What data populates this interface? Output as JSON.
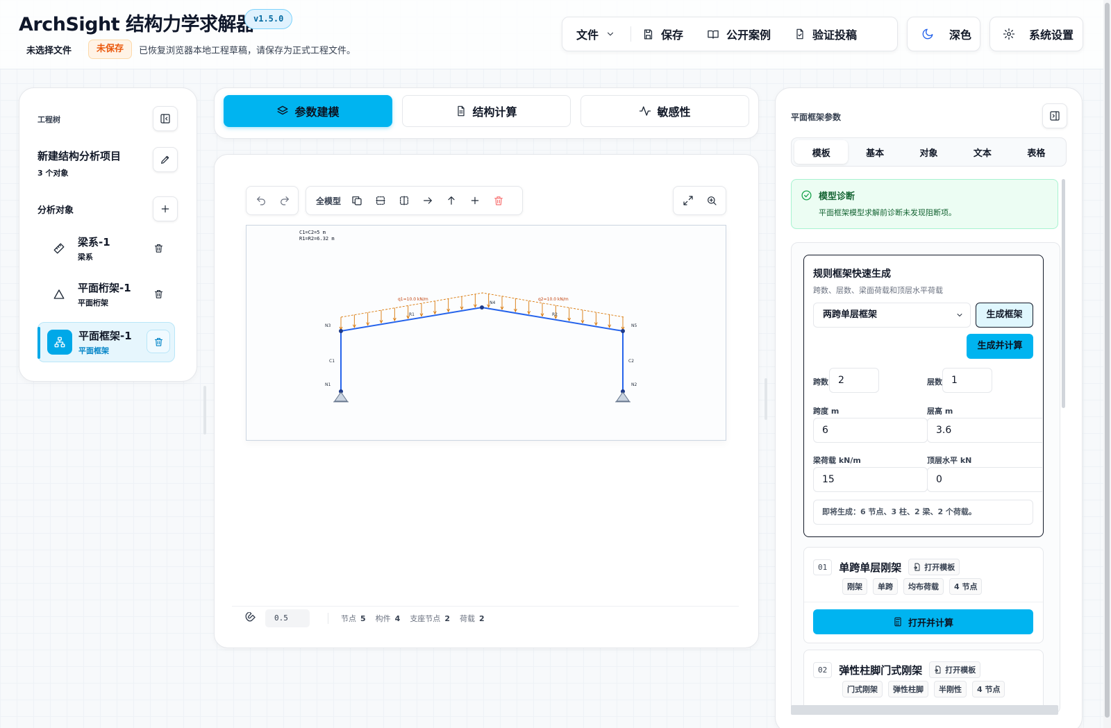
{
  "app": {
    "title": "ArchSight 结构力学求解器",
    "version": "v1.5.0",
    "file_status": "未选择文件",
    "unsaved_badge": "未保存",
    "draft_message": "已恢复浏览器本地工程草稿，请保存为正式工程文件。"
  },
  "toolbar": {
    "file": "文件",
    "save": "保存",
    "cases": "公开案例",
    "verify": "验证投稿",
    "theme": "深色",
    "settings": "系统设置"
  },
  "sidebar": {
    "title": "工程树",
    "project_name": "新建结构分析项目",
    "project_count": "3 个对象",
    "section": "分析对象",
    "items": [
      {
        "name": "梁系-1",
        "type": "梁系"
      },
      {
        "name": "平面桁架-1",
        "type": "平面桁架"
      },
      {
        "name": "平面框架-1",
        "type": "平面框架"
      }
    ]
  },
  "tabs": [
    {
      "label": "参数建模"
    },
    {
      "label": "结构计算"
    },
    {
      "label": "敏感性"
    }
  ],
  "canvas": {
    "view_all": "全模型",
    "note_line1": "C1=C2=5 m",
    "note_line2": "R1=R2=6.32 m",
    "load_labels": [
      "q1=10.0 kN/m",
      "q2=10.0 kN/m"
    ],
    "node_labels": [
      "N1",
      "N2",
      "N3",
      "N4",
      "N5"
    ],
    "member_labels": [
      "C1",
      "C2",
      "R1",
      "R2"
    ]
  },
  "status": {
    "value": "0.5",
    "nodes_label": "节点",
    "nodes": "5",
    "members_label": "构件",
    "members": "4",
    "supports_label": "支座节点",
    "supports": "2",
    "loads_label": "荷载",
    "loads": "2"
  },
  "right": {
    "title": "平面框架参数",
    "tabs": [
      "模板",
      "基本",
      "对象",
      "文本",
      "表格"
    ],
    "diag_title": "模型诊断",
    "diag_msg": "平面框架模型求解前诊断未发现阻断项。",
    "gen_title": "规则框架快速生成",
    "gen_sub": "跨数、层数、梁面荷载和顶层水平荷载",
    "template_select": "两跨单层框架",
    "gen_btn": "生成框架",
    "gen_calc_btn": "生成并计算",
    "spans_label": "跨数",
    "spans": "2",
    "stories_label": "层数",
    "stories": "1",
    "span_len_label": "跨度 m",
    "span_len": "6",
    "story_h_label": "层高 m",
    "story_h": "3.6",
    "beam_load_label": "梁荷载 kN/m",
    "beam_load": "15",
    "top_h_label": "顶层水平 kN",
    "top_h": "0",
    "preview": "即将生成：6 节点、3 柱、2 梁、2 个荷载。",
    "templates": [
      {
        "num": "01",
        "name": "单跨单层刚架",
        "open": "打开模板",
        "tags": [
          "刚架",
          "单跨",
          "均布荷载",
          "4 节点"
        ],
        "calc": "打开并计算"
      },
      {
        "num": "02",
        "name": "弹性柱脚门式刚架",
        "open": "打开模板",
        "tags": [
          "门式刚架",
          "弹性柱脚",
          "半刚性",
          "4 节点"
        ]
      }
    ]
  },
  "colors": {
    "accent": "#00b4f0",
    "frame": "#2563eb",
    "load": "#d97706",
    "success": "#16a34a"
  }
}
